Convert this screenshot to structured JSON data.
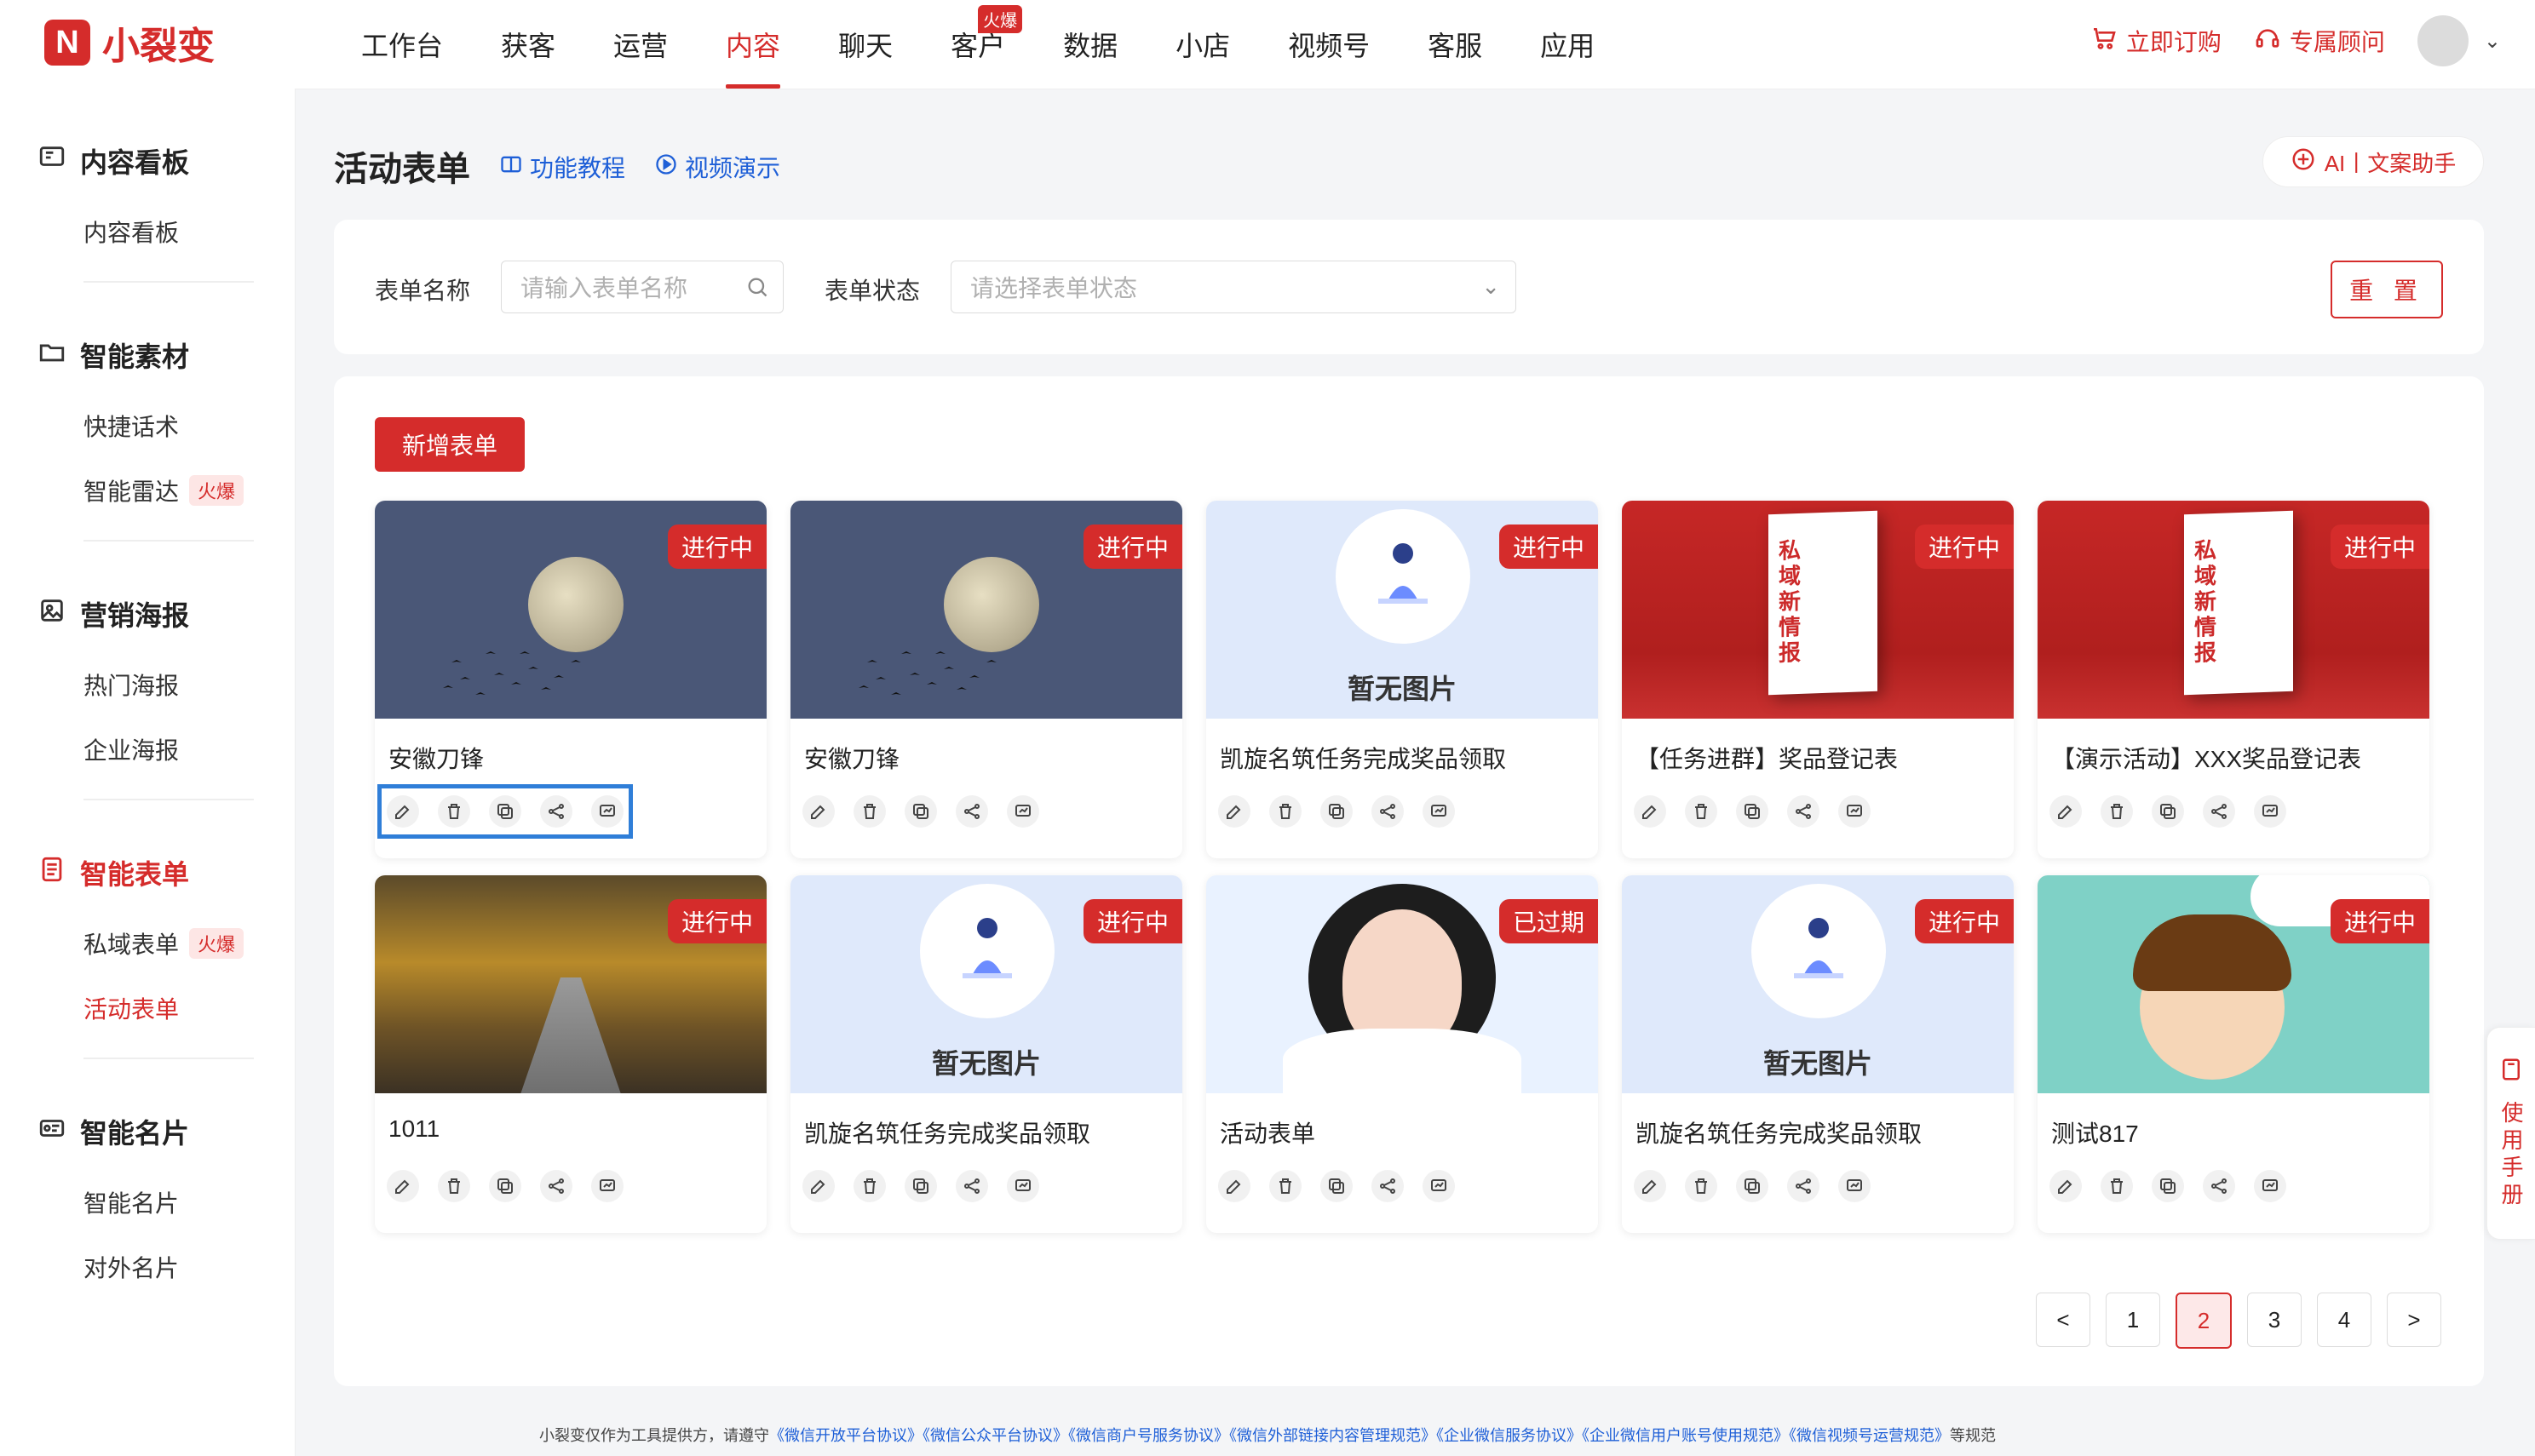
{
  "brand": {
    "name": "小裂变",
    "logo_icon": "N"
  },
  "nav": {
    "items": [
      "工作台",
      "获客",
      "运营",
      "内容",
      "聊天",
      "客户",
      "数据",
      "小店",
      "视频号",
      "客服",
      "应用"
    ],
    "active_index": 3,
    "hot_badge_on": "客户",
    "hot_label": "火爆"
  },
  "top_actions": {
    "order": "立即订购",
    "advisor": "专属顾问"
  },
  "sidebar": {
    "groups": [
      {
        "title": "内容看板",
        "icon": "dashboard-icon",
        "items": [
          "内容看板"
        ]
      },
      {
        "title": "智能素材",
        "icon": "folder-icon",
        "items": [
          "快捷话术",
          "智能雷达"
        ]
      },
      {
        "title": "营销海报",
        "icon": "poster-icon",
        "items": [
          "热门海报",
          "企业海报"
        ]
      },
      {
        "title": "智能表单",
        "icon": "form-icon",
        "items": [
          "私域表单",
          "活动表单"
        ]
      },
      {
        "title": "智能名片",
        "icon": "card-icon",
        "items": [
          "智能名片",
          "对外名片"
        ]
      }
    ],
    "badge": "火爆"
  },
  "page": {
    "title": "活动表单",
    "link_tutorial": "功能教程",
    "link_video": "视频演示",
    "ai_button": "AI丨文案助手"
  },
  "filters": {
    "name_label": "表单名称",
    "name_placeholder": "请输入表单名称",
    "status_label": "表单状态",
    "status_placeholder": "请选择表单状态",
    "reset": "重 置"
  },
  "actions": {
    "add": "新增表单"
  },
  "cards": [
    {
      "title": "安徽刀锋",
      "status": "进行中",
      "image": "moon"
    },
    {
      "title": "安徽刀锋",
      "status": "进行中",
      "image": "moon"
    },
    {
      "title": "凯旋名筑任务完成奖品领取",
      "status": "进行中",
      "image": "noimg"
    },
    {
      "title": "【任务进群】奖品登记表",
      "status": "进行中",
      "image": "book"
    },
    {
      "title": "【演示活动】XXX奖品登记表",
      "status": "进行中",
      "image": "book"
    },
    {
      "title": "1011",
      "status": "进行中",
      "image": "road"
    },
    {
      "title": "凯旋名筑任务完成奖品领取",
      "status": "进行中",
      "image": "noimg"
    },
    {
      "title": "活动表单",
      "status": "已过期",
      "image": "girl"
    },
    {
      "title": "凯旋名筑任务完成奖品领取",
      "status": "进行中",
      "image": "noimg"
    },
    {
      "title": "测试817",
      "status": "进行中",
      "image": "cartoon"
    }
  ],
  "no_image_text": "暂无图片",
  "book_text": "私域新情报",
  "pagination": {
    "pages": [
      "1",
      "2",
      "3",
      "4"
    ],
    "current": "2",
    "prev": "<",
    "next": ">"
  },
  "manual_tab": "使用手册",
  "footer": {
    "prefix": "小裂变仅作为工具提供方，请遵守",
    "links": [
      "《微信开放平台协议》",
      "《微信公众平台协议》",
      "《微信商户号服务协议》",
      "《微信外部链接内容管理规范》",
      "《企业微信服务协议》",
      "《企业微信用户账号使用规范》",
      "《微信视频号运营规范》"
    ],
    "suffix": "等规范"
  }
}
